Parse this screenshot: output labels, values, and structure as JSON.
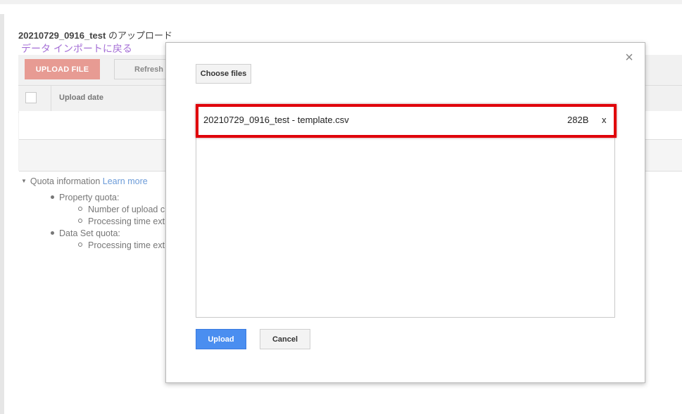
{
  "page": {
    "title_bold": "20210729_0916_test",
    "title_suffix": " のアップロード",
    "back_link": "データ インポートに戻る"
  },
  "toolbar": {
    "upload_file_label": "UPLOAD FILE",
    "refresh_label": "Refresh"
  },
  "table": {
    "columns": [
      "Upload date"
    ]
  },
  "quota": {
    "label": "Quota information",
    "learn_more": "Learn more",
    "items": [
      {
        "label": "Property quota:",
        "sub": [
          "Number of upload c",
          "Processing time ext"
        ]
      },
      {
        "label": "Data Set quota:",
        "sub": [
          "Processing time ext"
        ]
      }
    ]
  },
  "modal": {
    "close_glyph": "×",
    "choose_files_label": "Choose files",
    "file": {
      "name": "20210729_0916_test - template.csv",
      "size": "282B",
      "remove_glyph": "x"
    },
    "upload_label": "Upload",
    "cancel_label": "Cancel"
  },
  "colors": {
    "primary": "#4a8ef0",
    "upload_file_bg": "#e79b93",
    "highlight": "#e0000a",
    "link_purple": "#a56fd6",
    "link_blue": "#6b9bd8"
  }
}
